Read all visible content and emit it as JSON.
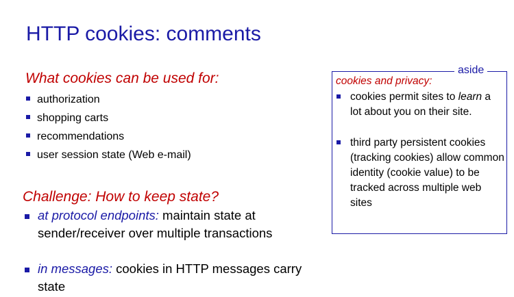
{
  "title": "HTTP cookies: comments",
  "uses": {
    "heading": "What cookies can be used for:",
    "items": [
      "authorization",
      "shopping carts",
      "recommendations",
      "user session state (Web e-mail)"
    ]
  },
  "challenge": {
    "heading": "Challenge: How to keep state?",
    "items": [
      {
        "lead": "at protocol endpoints:",
        "rest": " maintain state at sender/receiver over multiple transactions"
      },
      {
        "lead": "in messages:",
        "rest": " cookies in HTTP messages carry state"
      }
    ]
  },
  "aside": {
    "label": "aside",
    "heading": "cookies and privacy:",
    "item1": {
      "pre": "cookies permit sites to ",
      "em": "learn",
      "post": " a lot about you on their site."
    },
    "item2": "third party persistent cookies (tracking cookies) allow common identity (cookie value) to be tracked across multiple web sites"
  },
  "colors": {
    "title": "#1a1aa6",
    "accent": "#c00000"
  }
}
